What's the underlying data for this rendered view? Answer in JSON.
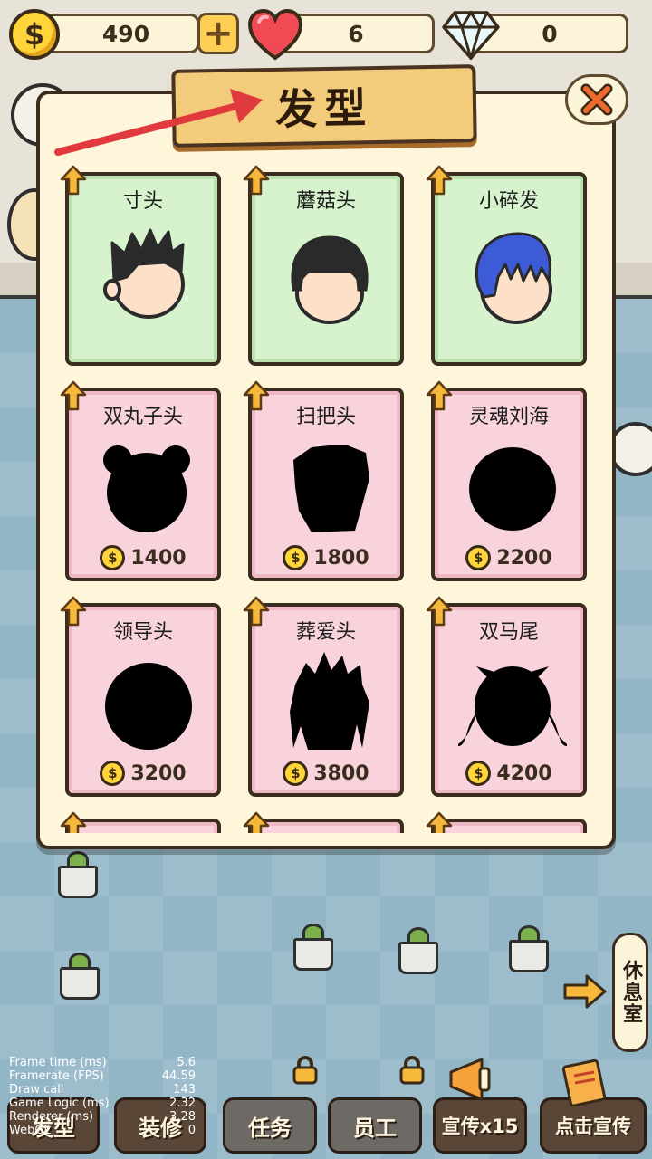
{
  "topbar": {
    "coins": "490",
    "hearts": "6",
    "gems": "0",
    "coin_symbol": "$"
  },
  "modal": {
    "title": "发型",
    "close_symbol": "✕",
    "cards": [
      {
        "name": "寸头",
        "state": "owned",
        "price": ""
      },
      {
        "name": "蘑菇头",
        "state": "owned",
        "price": ""
      },
      {
        "name": "小碎发",
        "state": "owned",
        "price": ""
      },
      {
        "name": "双丸子头",
        "state": "locked",
        "price": "1400"
      },
      {
        "name": "扫把头",
        "state": "locked",
        "price": "1800"
      },
      {
        "name": "灵魂刘海",
        "state": "locked",
        "price": "2200"
      },
      {
        "name": "领导头",
        "state": "locked",
        "price": "3200"
      },
      {
        "name": "葬爱头",
        "state": "locked",
        "price": "3800"
      },
      {
        "name": "双马尾",
        "state": "locked",
        "price": "4200"
      },
      {
        "name": "",
        "state": "locked",
        "price": ""
      },
      {
        "name": "",
        "state": "locked",
        "price": ""
      },
      {
        "name": "",
        "state": "locked",
        "price": ""
      }
    ]
  },
  "side_button": {
    "label": "休息室"
  },
  "bottombar": {
    "items": [
      {
        "label": "发型"
      },
      {
        "label": "装修"
      },
      {
        "label": "任务"
      },
      {
        "label": "员工"
      },
      {
        "label": "宣传x15"
      },
      {
        "label": "点击宣传"
      }
    ]
  },
  "debug": {
    "rows": [
      {
        "label": "Frame time (ms)",
        "value": "5.6"
      },
      {
        "label": "Framerate (FPS)",
        "value": "44.59"
      },
      {
        "label": "Draw call",
        "value": "143"
      },
      {
        "label": "Game Logic (ms)",
        "value": "2.32"
      },
      {
        "label": "Renderer (ms)",
        "value": "3.28"
      },
      {
        "label": "WebGL",
        "value": "0"
      }
    ]
  },
  "colors": {
    "owned_card": "#d6f3cd",
    "locked_card": "#f8d3db",
    "coin": "#ffd53a",
    "arrow_red": "#e0393e"
  }
}
